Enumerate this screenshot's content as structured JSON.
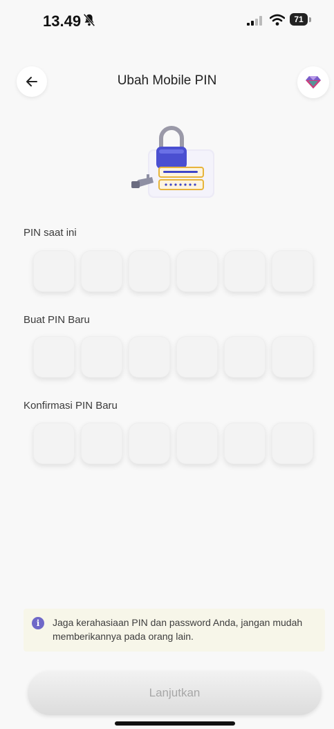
{
  "status_bar": {
    "time": "13.49",
    "battery_level": "71",
    "icons": [
      "bell-off-icon",
      "signal-icon",
      "wifi-icon",
      "battery-icon"
    ]
  },
  "header": {
    "title": "Ubah Mobile PIN",
    "back_icon": "arrow-left-icon",
    "right_icon": "gem-icon"
  },
  "fields": {
    "current": {
      "label": "PIN saat ini",
      "digits": 6
    },
    "new": {
      "label": "Buat PIN Baru",
      "digits": 6
    },
    "confirm": {
      "label": "Konfirmasi PIN Baru",
      "digits": 6
    }
  },
  "info": {
    "icon": "info-icon",
    "text": "Jaga kerahasiaan PIN dan password Anda, jangan mudah memberikannya pada orang lain."
  },
  "actions": {
    "continue_label": "Lanjutkan"
  },
  "colors": {
    "accent": "#6f68c8",
    "info_bg": "#f7f6e9",
    "button_disabled_text": "#a7a7a7"
  }
}
